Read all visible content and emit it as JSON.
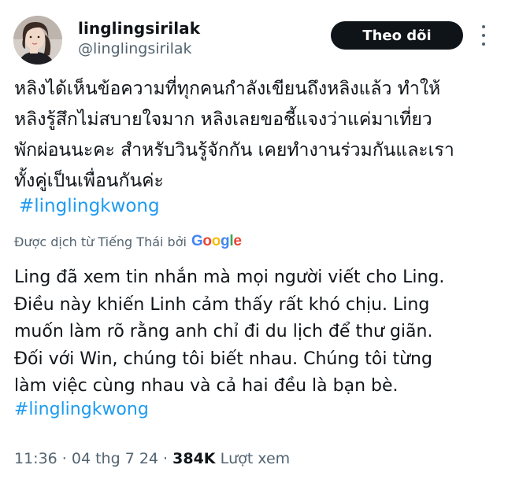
{
  "author": {
    "display_name": "linglingsirilak",
    "handle": "@linglingsirilak"
  },
  "actions": {
    "follow_label": "Theo dõi",
    "more_icon": "more-horizontal-icon"
  },
  "tweet": {
    "original_lines": [
      "หลิงได้เห็นข้อความที่ทุกคนกำลังเขียนถึงหลิงแล้ว ทำให้",
      "หลิงรู้สึกไม่สบายใจมาก หลิงเลยขอชี้แจงว่าแค่มาเที่ยว",
      "พักผ่อนนะคะ สำหรับวินรู้จักกัน เคยทำงานร่วมกันและเรา",
      "ทั้งคู่เป็นเพื่อนกันค่ะ"
    ],
    "hashtag": "#linglingkwong",
    "translated_by": "Được dịch từ Tiếng Thái bởi",
    "translator_brand": {
      "letters": [
        "G",
        "o",
        "o",
        "g",
        "l",
        "e"
      ],
      "colors": [
        "#4285F4",
        "#EA4335",
        "#FBBC05",
        "#4285F4",
        "#34A853",
        "#EA4335"
      ]
    },
    "translation_lines": [
      "Ling đã xem tin nhắn mà mọi người viết cho Ling.",
      "Điều này khiến Linh cảm thấy rất khó chịu. Ling",
      "muốn làm rõ rằng anh chỉ đi du lịch để thư giãn.",
      "Đối với Win, chúng tôi biết nhau. Chúng tôi từng",
      "làm việc cùng nhau và cả hai đều là bạn bè."
    ],
    "translation_hashtag": "#linglingkwong"
  },
  "meta": {
    "time": "11:36",
    "separator_1": " · ",
    "date": "04 thg 7 24",
    "separator_2": " · ",
    "views_count": "384K",
    "views_label": " Lượt xem"
  },
  "colors": {
    "link": "#1d9bf0",
    "text": "#0f1419",
    "secondary": "#536471",
    "button_bg": "#0f1419"
  }
}
